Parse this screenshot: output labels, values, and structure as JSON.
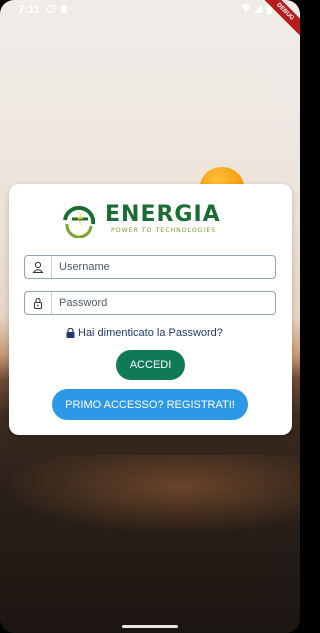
{
  "status_bar": {
    "time": "7:11",
    "debug_banner": "DEBUG"
  },
  "logo": {
    "word": "ENERGIA",
    "tagline": "POWER TO TECHNOLOGIES",
    "colors": {
      "primary": "#1a6e33",
      "accent": "#7aa630"
    }
  },
  "login_form": {
    "username_placeholder": "Username",
    "username_icon": "person-icon",
    "password_placeholder": "Password",
    "password_icon": "lock-icon",
    "forgot_password_label": "Hai dimenticato la Password?",
    "login_button_label": "ACCEDI",
    "register_button_label": "PRIMO ACCESSO? REGISTRATI!"
  },
  "colors": {
    "login_button": "#0f7a57",
    "register_button": "#2d98e6",
    "link": "#203a6b"
  }
}
